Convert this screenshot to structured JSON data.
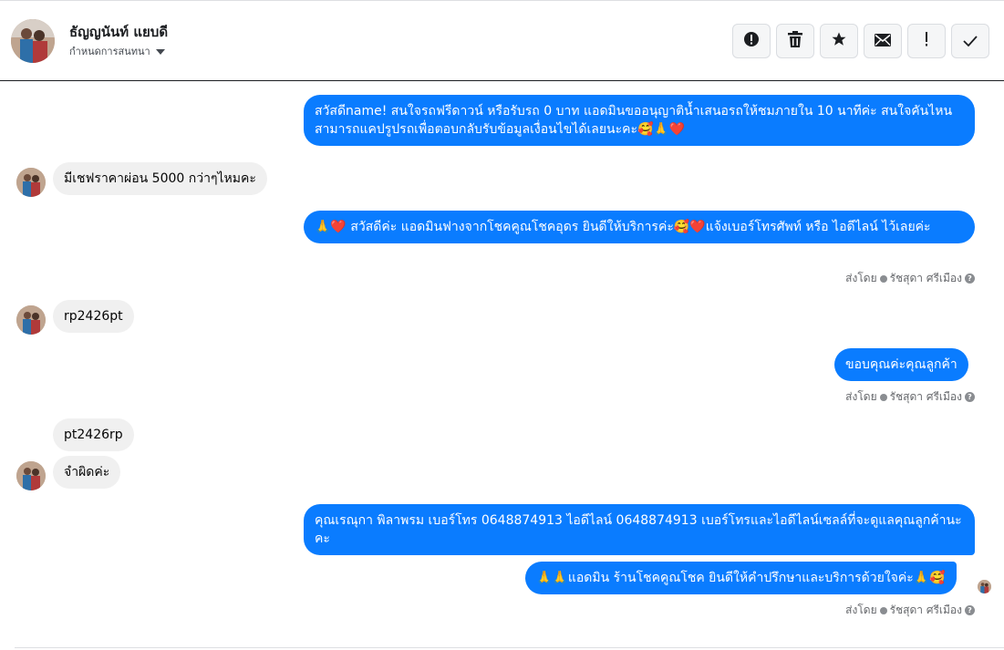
{
  "header": {
    "name": "ธัญญนันท์ แยบดี",
    "subtitle": "กำหนดการสนทนา",
    "actions": [
      {
        "name": "report-button",
        "icon": "alert-circle-icon"
      },
      {
        "name": "delete-button",
        "icon": "trash-icon"
      },
      {
        "name": "star-button",
        "icon": "star-icon"
      },
      {
        "name": "mark-unread-button",
        "icon": "envelope-icon"
      },
      {
        "name": "important-button",
        "icon": "exclamation-icon"
      },
      {
        "name": "mark-done-button",
        "icon": "check-icon"
      }
    ]
  },
  "messages": {
    "m1": "สวัสดีname! สนใจรถฟรีดาวน์ หรือรับรถ 0 บาท แอดมินขออนุญาติน้ำเสนอรถให้ชมภายใน 10 นาทีค่ะ สนใจคันไหนสามารถแคปรูปรถเพื่อตอบกลับรับข้อมูลเงื่อนไขได้เลยนะคะ🥰🙏❤️",
    "m2": "มีเชฟราคาผ่อน 5000 กว่าๆไหมคะ",
    "m3": "🙏❤️ สวัสดีค่ะ แอดมินฟางจากโชคคูณโชคอุดร ยินดีให้บริการค่ะ🥰❤️แจ้งเบอร์โทรศัพท์ หรือ ไอดีไลน์  ไว้เลยค่ะ",
    "m4": "rp2426pt",
    "m5": "ขอบคุณค่ะคุณลูกค้า",
    "m6": "pt2426rp",
    "m7": "จำผิดค่ะ",
    "m8": "คุณเรณุกา พิลาพรม        เบอร์โทร 0648874913  ไอดีไลน์ 0648874913  เบอร์โทรและไอดีไลน์เซลล์ที่จะดูแลคุณลูกค้านะคะ",
    "m9": "🙏🙏แอดมิน ร้านโชคคูณโชค ยินดีให้คำปรึกษาและบริการด้วยใจค่ะ🙏🥰"
  },
  "sent_by": {
    "label": "ส่งโดย",
    "agent": "รัชสุดา ศรีเมือง",
    "help": "?"
  }
}
